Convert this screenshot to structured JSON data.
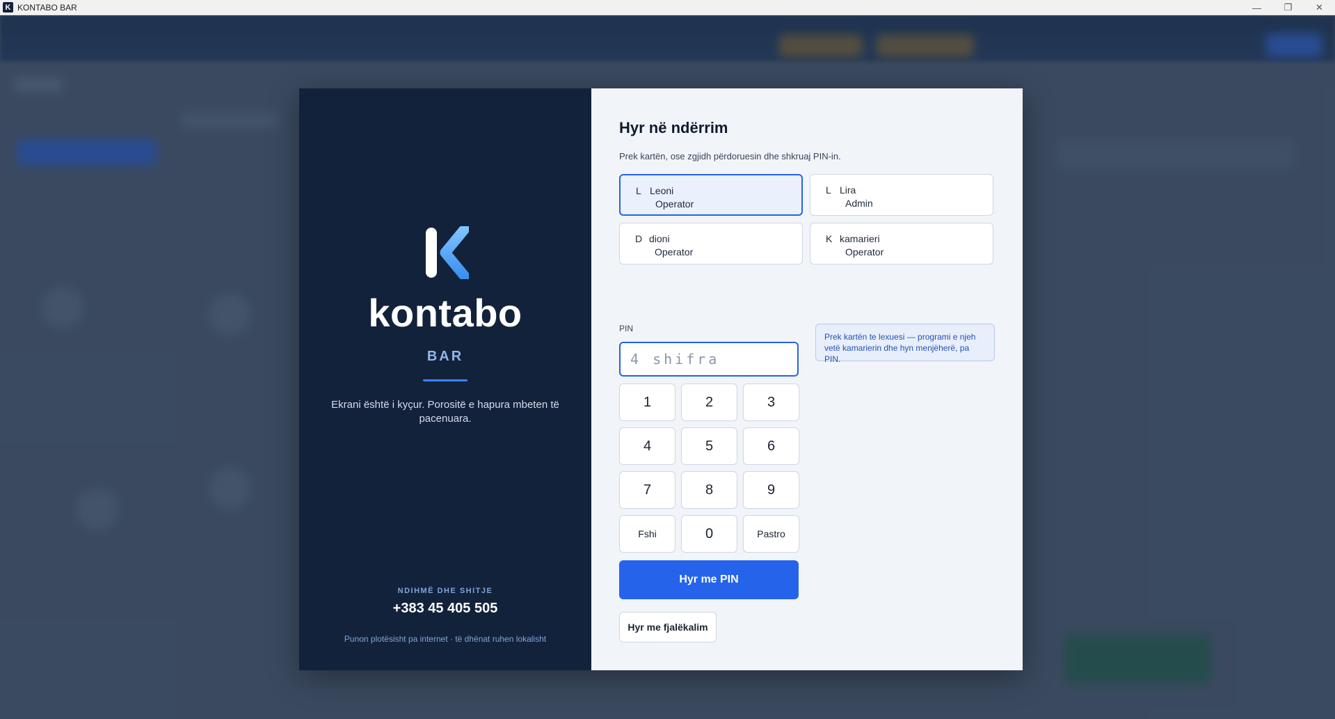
{
  "window": {
    "app_icon_letter": "K",
    "title": "KONTABO BAR",
    "controls": {
      "minimize": "—",
      "maximize": "❐",
      "close": "✕"
    }
  },
  "brand": {
    "name": "kontabo",
    "sub": "BAR",
    "lock_message": "Ekrani është i kyçur. Porositë e hapura mbeten të pacenuara.",
    "help_label": "NDIHMË DHE SHITJE",
    "help_phone": "+383 45 405 505",
    "help_note": "Punon plotësisht pa internet · të dhënat ruhen lokalisht",
    "logo_colors": {
      "bar": "#ffffff",
      "arrow_top": "#7fc4ff",
      "arrow_bottom": "#3b8ff0"
    }
  },
  "login": {
    "title": "Hyr në ndërrim",
    "subtitle": "Prek kartën, ose zgjidh përdoruesin dhe shkruaj PIN-in.",
    "users": [
      {
        "initial": "L",
        "name": "Leoni",
        "role": "Operator",
        "selected": true
      },
      {
        "initial": "L",
        "name": "Lira",
        "role": "Admin",
        "selected": false
      },
      {
        "initial": "D",
        "name": "dioni",
        "role": "Operator",
        "selected": false
      },
      {
        "initial": "K",
        "name": "kamarieri",
        "role": "Operator",
        "selected": false
      }
    ],
    "pin_label": "PIN",
    "pin_value": "",
    "pin_placeholder": "4 shifra",
    "keypad": [
      "1",
      "2",
      "3",
      "4",
      "5",
      "6",
      "7",
      "8",
      "9",
      "Fshi",
      "0",
      "Pastro"
    ],
    "login_pin_label": "Hyr me PIN",
    "login_password_label": "Hyr me fjalëkalim",
    "card_hint": "Prek kartën te lexuesi — programi e njeh vetë kamarierin dhe hyn menjëherë, pa PIN."
  },
  "colors": {
    "accent": "#2563eb",
    "brand_panel": "#13223b",
    "form_panel": "#f1f4f9"
  }
}
